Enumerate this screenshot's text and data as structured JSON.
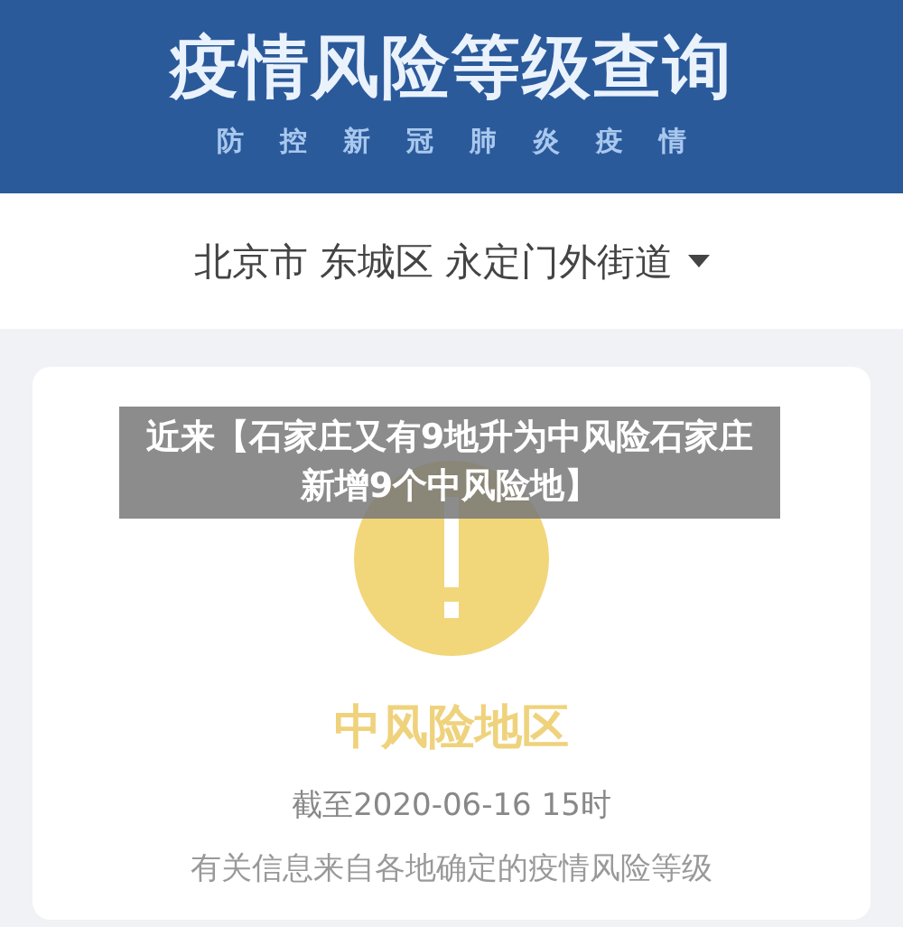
{
  "header": {
    "title": "疫情风险等级查询",
    "subtitle": [
      "防",
      "控",
      "新",
      "冠",
      "肺",
      "炎",
      "疫",
      "情"
    ]
  },
  "location": {
    "value": "北京市 东城区 永定门外街道"
  },
  "result": {
    "kind": "medium",
    "label": "中风险地区",
    "time": "截至2020-06-16 15时",
    "note": "有关信息来自各地确定的疫情风险等级"
  },
  "caption": "近来【石家庄又有9地升为中风险石家庄新增9个中风险地】"
}
